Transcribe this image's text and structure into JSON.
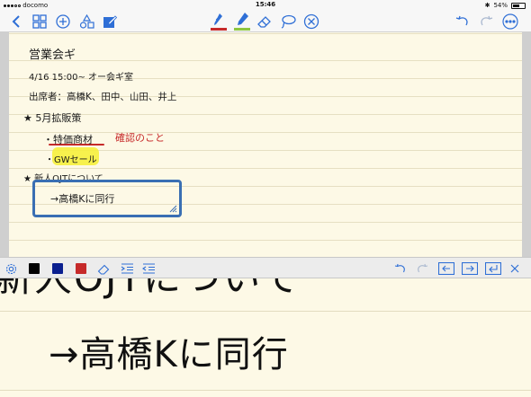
{
  "status_bar": {
    "carrier": "docomo",
    "time": "15:46",
    "battery": "54%"
  },
  "toolbar": {
    "icons_left": [
      "back-icon",
      "grid-icon",
      "add-icon",
      "shapes-icon",
      "edit-note-icon"
    ],
    "icons_center": [
      "pen-icon",
      "highlighter-icon",
      "eraser-icon",
      "lasso-icon",
      "close-circle-icon"
    ],
    "icons_right": [
      "undo-icon",
      "redo-icon",
      "more-icon"
    ],
    "pen_color": "#c62a2a",
    "highlighter_color": "#8ec63f",
    "accent": "#2f6fd6"
  },
  "note": {
    "title": "営業会ギ",
    "line1": "4/16 15:00~ オー会ギ室",
    "line2": "出席者：高橋K、田中、山田、井上",
    "line3": "★ 5月拡販策",
    "line4": "・特価商材",
    "line4_red": "確認のこと",
    "line5": "・GWセール",
    "line6": "★ 新人OJTについて",
    "line7": "→高橋Kに同行"
  },
  "zoom_panel": {
    "swatches": [
      "#000000",
      "#0a1f8f",
      "#c62a2a"
    ],
    "top_text": "新人OJTについて",
    "main_text": "→高橋Kに同行"
  }
}
